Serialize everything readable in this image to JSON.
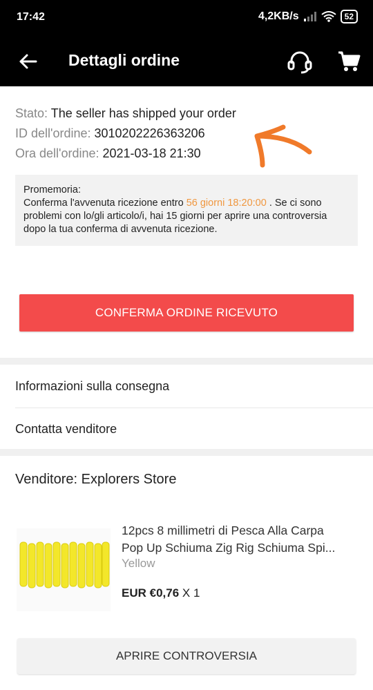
{
  "status_bar": {
    "time": "17:42",
    "network_speed": "4,2KB/s",
    "battery": "52"
  },
  "header": {
    "title": "Dettagli ordine",
    "icons": [
      "back-arrow-icon",
      "headset-support-icon",
      "shopping-cart-icon"
    ]
  },
  "order": {
    "status_label": "Stato:",
    "status_value": "The seller has shipped your order",
    "id_label": "ID dell'ordine:",
    "id_value": "3010202226363206",
    "time_label": "Ora dell'ordine:",
    "time_value": "2021-03-18 21:30"
  },
  "reminder": {
    "title": "Promemoria:",
    "text_before": "Conferma l'avvenuta ricezione entro",
    "highlight": "56 giorni 18:20:00",
    "text_after": ". Se ci sono problemi con lo/gli articolo/i, hai 15 giorni per aprire una controversia dopo la tua conferma di avvenuta ricezione."
  },
  "confirm_button": "CONFERMA ORDINE RICEVUTO",
  "menu": {
    "delivery_info": "Informazioni sulla consegna",
    "contact_seller": "Contatta venditore"
  },
  "seller": {
    "label": "Venditore: Explorers Store"
  },
  "product": {
    "title_line1": "12pcs 8 millimetri di Pesca Alla Carpa",
    "title_line2": "Pop Up Schiuma Zig Rig Schiuma Spi...",
    "variant": "Yellow",
    "price": "EUR €0,76",
    "quantity": "X 1"
  },
  "dispute_button": "APRIRE CONTROVERSIA",
  "colors": {
    "accent_red": "#f34b4b",
    "highlight_orange": "#f0973f",
    "annotation_orange": "#f07a2a",
    "header_bg": "#000000"
  }
}
